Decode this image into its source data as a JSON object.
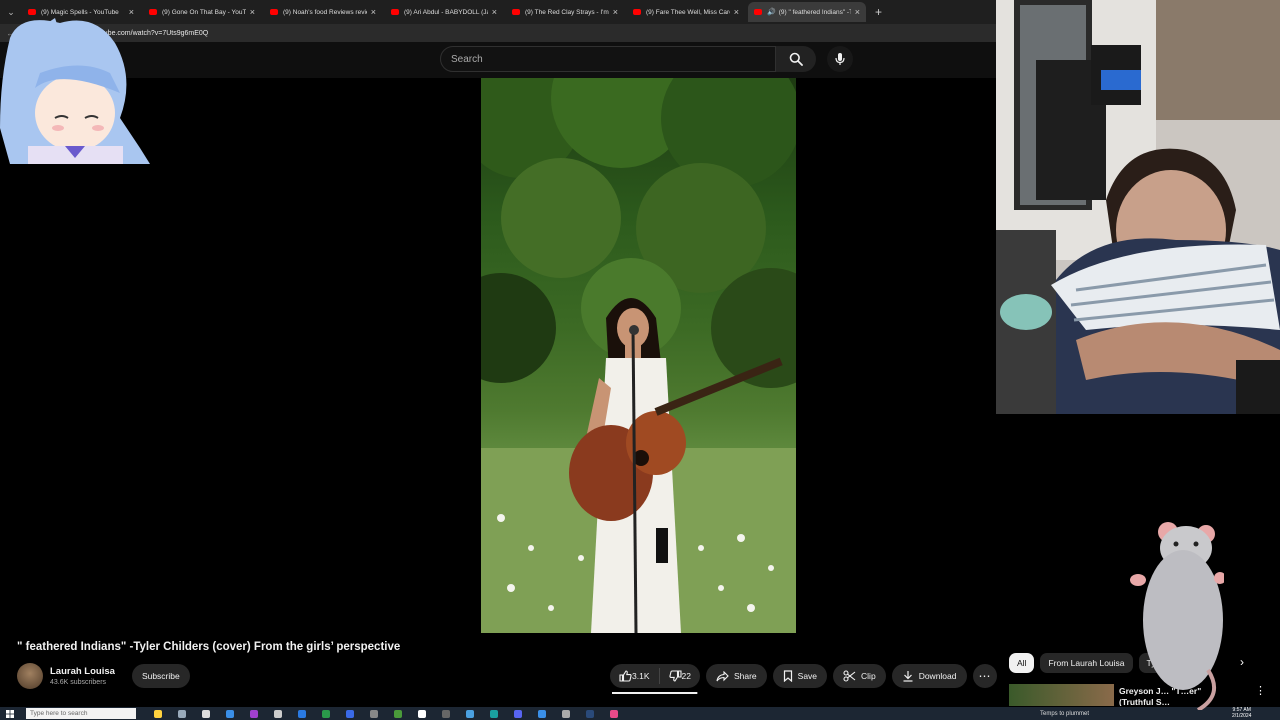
{
  "browser": {
    "tabs": [
      {
        "title": "(9) Magic Spells - YouTube",
        "active": false
      },
      {
        "title": "(9) Gone On That Bay - YouTube",
        "active": false
      },
      {
        "title": "(9) Noah's food Reviews reviews h",
        "active": false
      },
      {
        "title": "(9) Ari Abdul - BABYDOLL (Jason N",
        "active": false
      },
      {
        "title": "(9) The Red Clay Strays - I'm Still F",
        "active": false
      },
      {
        "title": "(9) Fare Thee Well, Miss Carousel",
        "active": false
      },
      {
        "title": "(9) \" feathered Indians\" -Tyle",
        "active": true
      }
    ],
    "new_tab": "+",
    "url": "youtube.com/watch?v=7Uts9g6mE0Q"
  },
  "header": {
    "search_placeholder": "Search"
  },
  "video": {
    "title": "\" feathered Indians\" -Tyler Childers (cover) From the girls’ perspective",
    "channel": {
      "name": "Laurah Louisa",
      "subscribers": "43.6K subscribers"
    },
    "subscribe_label": "Subscribe",
    "likes": "3.1K",
    "dislikes": "22",
    "like_ratio": 0.99,
    "share_label": "Share",
    "save_label": "Save",
    "clip_label": "Clip",
    "download_label": "Download",
    "more_label": "⋯"
  },
  "sidebar": {
    "chips": [
      "All",
      "From Laurah Louisa",
      "Ty",
      "G"
    ],
    "next_label": "›",
    "recommendation": {
      "title": "Greyson J… \"T…er\"",
      "subtitle": "(Truthful S…",
      "more": "⋮"
    }
  },
  "taskbar": {
    "search_placeholder": "Type here to search",
    "tray_text": "Temps to plummet",
    "time": "9:57 AM",
    "date": "2/1/2024"
  },
  "colors": {
    "background": "#000000",
    "header": "#0f0f0f",
    "pill": "#272727",
    "tab_favicon": "#ff0000"
  }
}
